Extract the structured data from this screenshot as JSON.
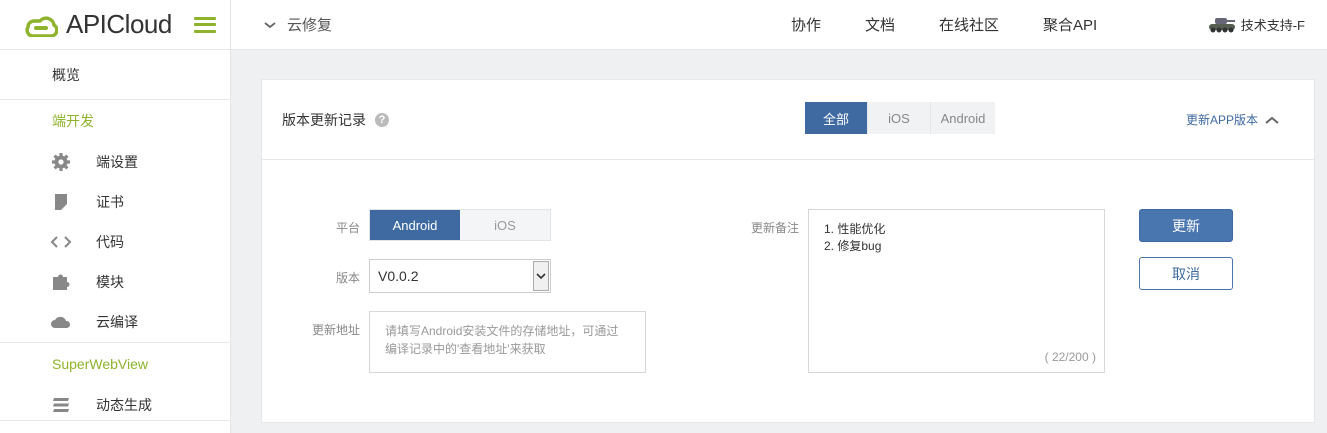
{
  "brand": {
    "name": "APICloud",
    "accent": "#8fb32d",
    "primary": "#3e6aa1"
  },
  "sidebar": {
    "overview": "概览",
    "groups": [
      {
        "title": "端开发",
        "items": [
          {
            "label": "端设置",
            "icon": "gear-icon"
          },
          {
            "label": "证书",
            "icon": "certificate-icon"
          },
          {
            "label": "代码",
            "icon": "code-icon"
          },
          {
            "label": "模块",
            "icon": "puzzle-icon"
          },
          {
            "label": "云编译",
            "icon": "cloud-icon"
          }
        ]
      },
      {
        "title": "SuperWebView",
        "items": [
          {
            "label": "动态生成",
            "icon": "layers-icon"
          }
        ]
      }
    ]
  },
  "topbar": {
    "project": "云修复",
    "links": [
      "协作",
      "文档",
      "在线社区",
      "聚合API"
    ],
    "user": "技术支持-F"
  },
  "panel": {
    "title": "版本更新记录",
    "filter_tabs": [
      "全部",
      "iOS",
      "Android"
    ],
    "filter_active": "全部",
    "update_app_link": "更新APP版本",
    "form": {
      "platform_label": "平台",
      "platform_options": [
        "Android",
        "iOS"
      ],
      "platform_selected": "Android",
      "version_label": "版本",
      "version_value": "V0.0.2",
      "url_label": "更新地址",
      "url_placeholder": "请填写Android安装文件的存储地址，可通过编译记录中的'查看地址'来获取",
      "notes_label": "更新备注",
      "notes_lines": [
        "1. 性能优化",
        "2. 修复bug"
      ],
      "notes_counter": "( 22/200 )",
      "submit_label": "更新",
      "cancel_label": "取消"
    }
  }
}
